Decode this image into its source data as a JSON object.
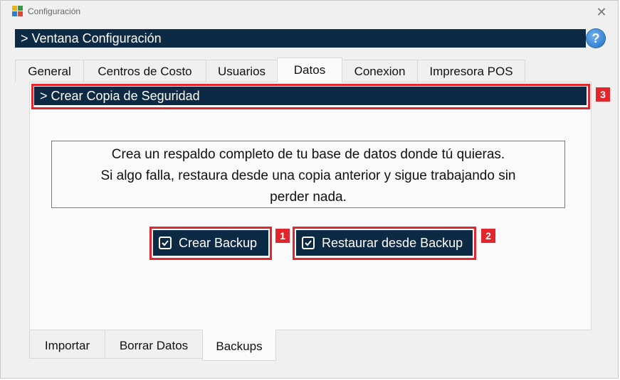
{
  "window": {
    "title": "Configuración",
    "close_glyph": "✕",
    "app_icon": "app-logo-icon"
  },
  "header": {
    "title": "> Ventana Configuración",
    "help_glyph": "?",
    "help_icon": "help-icon"
  },
  "top_tabs": [
    {
      "label": "General"
    },
    {
      "label": "Centros de Costo"
    },
    {
      "label": "Usuarios"
    },
    {
      "label": "Datos",
      "active": true
    },
    {
      "label": "Conexion"
    },
    {
      "label": "Impresora POS"
    }
  ],
  "section": {
    "title": "> Crear Copia de Seguridad"
  },
  "description": {
    "line1": "Crea un respaldo completo de tu base de datos donde tú quieras.",
    "line2": "Si algo falla, restaura desde una copia anterior y sigue trabajando sin",
    "line3": "perder nada."
  },
  "buttons": {
    "create_backup": "Crear Backup",
    "restore_backup": "Restaurar desde Backup",
    "icon": "checkbox-icon"
  },
  "annotations": {
    "badge1": "1",
    "badge2": "2",
    "badge3": "3",
    "highlight_color": "#e3262b"
  },
  "bottom_tabs": [
    {
      "label": "Importar"
    },
    {
      "label": "Borrar Datos"
    },
    {
      "label": "Backups",
      "active": true
    }
  ],
  "colors": {
    "navy": "#0d2a45",
    "window_bg": "#f0f0f0",
    "panel_bg": "#fafafa"
  }
}
